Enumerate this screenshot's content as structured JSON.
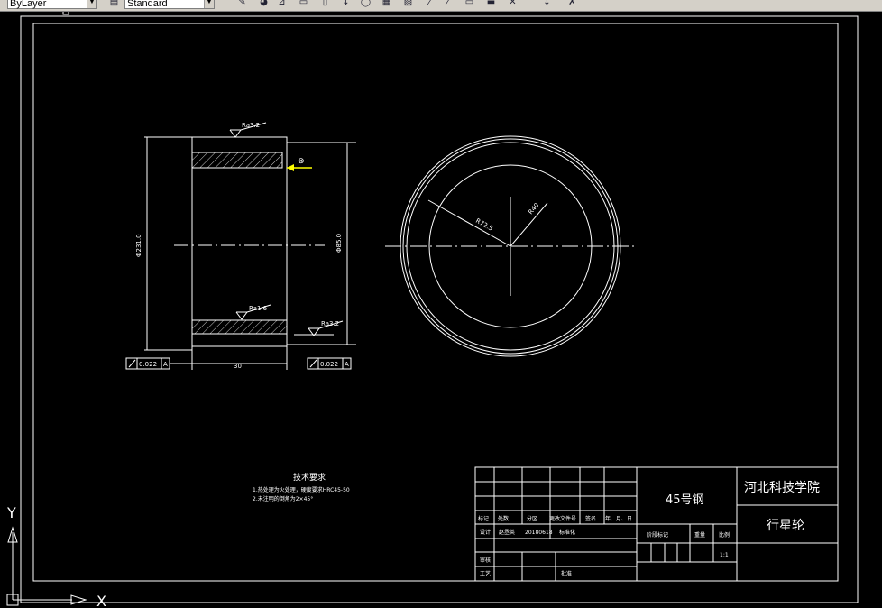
{
  "toolbar": {
    "layer_combo": "ByLayer",
    "style_combo": "Standard",
    "icons": [
      "layer-manager-icon",
      "match-properties-icon",
      "line-icon",
      "polyline-icon",
      "rectangle-icon",
      "arc-icon",
      "move-icon",
      "rotate-icon",
      "copy-icon",
      "hatch-icon",
      "dimension-icon",
      "trim-icon",
      "extend-icon",
      "text-icon",
      "table-icon",
      "block-icon",
      "zoom-icon",
      "undo-icon"
    ]
  },
  "colors": {
    "background": "#000000",
    "linework": "#ffffff",
    "highlight_leader": "#ffff00"
  },
  "section_view": {
    "roughness_top": "Ra3.2",
    "roughness_inner": "Ra1.6",
    "roughness_right": "Ra3.2",
    "dim_outer_diameter": "Φ231.0",
    "dim_inner_diameter": "Φ85.0",
    "dim_width": "30",
    "runout_left_value": "0.022",
    "runout_left_datum": "A",
    "runout_right_value": "0.022",
    "runout_right_datum": "A",
    "symbol": "⊗"
  },
  "front_view": {
    "radius_label_1": "R72.5",
    "radius_label_2": "R40"
  },
  "notes": {
    "title": "技术要求",
    "line1": "1.热处理为火处理，硬度要求HRC45-50",
    "line2": "2.未注明的倒角为2×45°"
  },
  "title_block": {
    "material": "45号钢",
    "school": "河北科技学院",
    "part_name": "行星轮",
    "headers": [
      "标记",
      "处数",
      "分区",
      "更改文件号",
      "签名",
      "年、月、日"
    ],
    "design_label": "设计",
    "designer": "赵丞英",
    "date": "20180618",
    "standard_label": "标准化",
    "review_label": "审核",
    "process_label": "工艺",
    "approve_label": "批准",
    "stage_label": "阶段标记",
    "weight_label": "重量",
    "scale_label": "比例",
    "scale": "1:1"
  },
  "ucs": {
    "x_label": "X",
    "y_label": "Y"
  }
}
